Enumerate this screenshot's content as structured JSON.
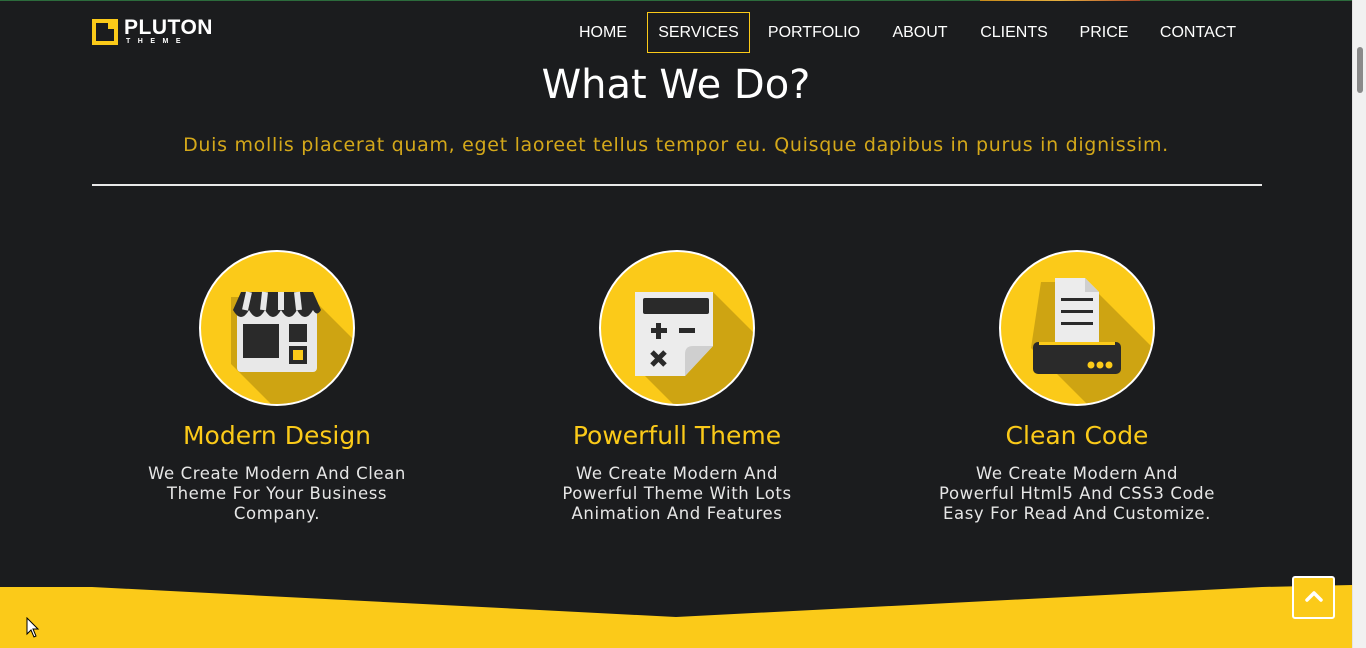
{
  "brand": {
    "name": "PLUTON",
    "tagline": "THEME"
  },
  "nav": {
    "items": [
      {
        "label": "HOME"
      },
      {
        "label": "SERVICES"
      },
      {
        "label": "PORTFOLIO"
      },
      {
        "label": "ABOUT"
      },
      {
        "label": "CLIENTS"
      },
      {
        "label": "PRICE"
      },
      {
        "label": "CONTACT"
      }
    ],
    "active": "SERVICES"
  },
  "section": {
    "title": "What We Do?",
    "subtitle": "Duis mollis placerat quam, eget laoreet tellus tempor eu. Quisque dapibus in purus in dignissim."
  },
  "features": [
    {
      "icon": "storefront-icon",
      "title": "Modern Design",
      "text": "We Create Modern And Clean Theme For Your Business Company."
    },
    {
      "icon": "calculator-icon",
      "title": "Powerfull Theme",
      "text": "We Create Modern And Powerful Theme With Lots Animation And Features"
    },
    {
      "icon": "printer-icon",
      "title": "Clean Code",
      "text": "We Create Modern And Powerful Html5 And CSS3 Code Easy For Read And Customize."
    }
  ],
  "colors": {
    "accent": "#fbca19",
    "background": "#1b1c1e",
    "text": "#ffffff",
    "subtitle": "#d4a81a"
  },
  "controls": {
    "scroll_top_icon": "chevron-up-icon"
  }
}
